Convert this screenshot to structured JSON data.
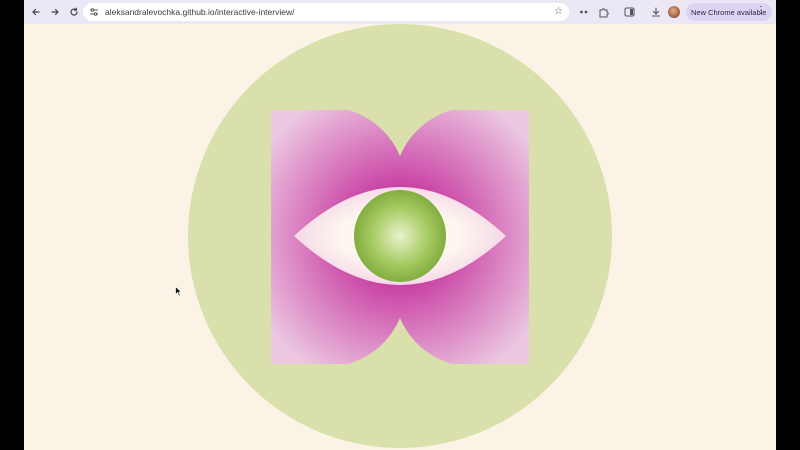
{
  "browser": {
    "url": "aleksandralevochka.github.io/interactive-interview/",
    "update_button_label": "New Chrome available",
    "icons": {
      "back": "arrow-left-icon",
      "forward": "arrow-right-icon",
      "reload": "reload-icon",
      "site_info": "tune-icon",
      "bookmark": "star-icon",
      "extensions_toolbar": "dots-icon",
      "extensions": "puzzle-icon",
      "side_panel": "side-panel-icon",
      "downloads": "download-icon",
      "profile": "avatar",
      "menu": "kebab-menu-icon"
    }
  },
  "page": {
    "background": "#fbf4e6",
    "circle_color": "#d9e0ab",
    "petal_colors": [
      "#c8239a",
      "#ecc6e2"
    ],
    "eye_white": "#fdf8ef",
    "iris_colors": [
      "#e6f2c4",
      "#7fae3a"
    ]
  }
}
